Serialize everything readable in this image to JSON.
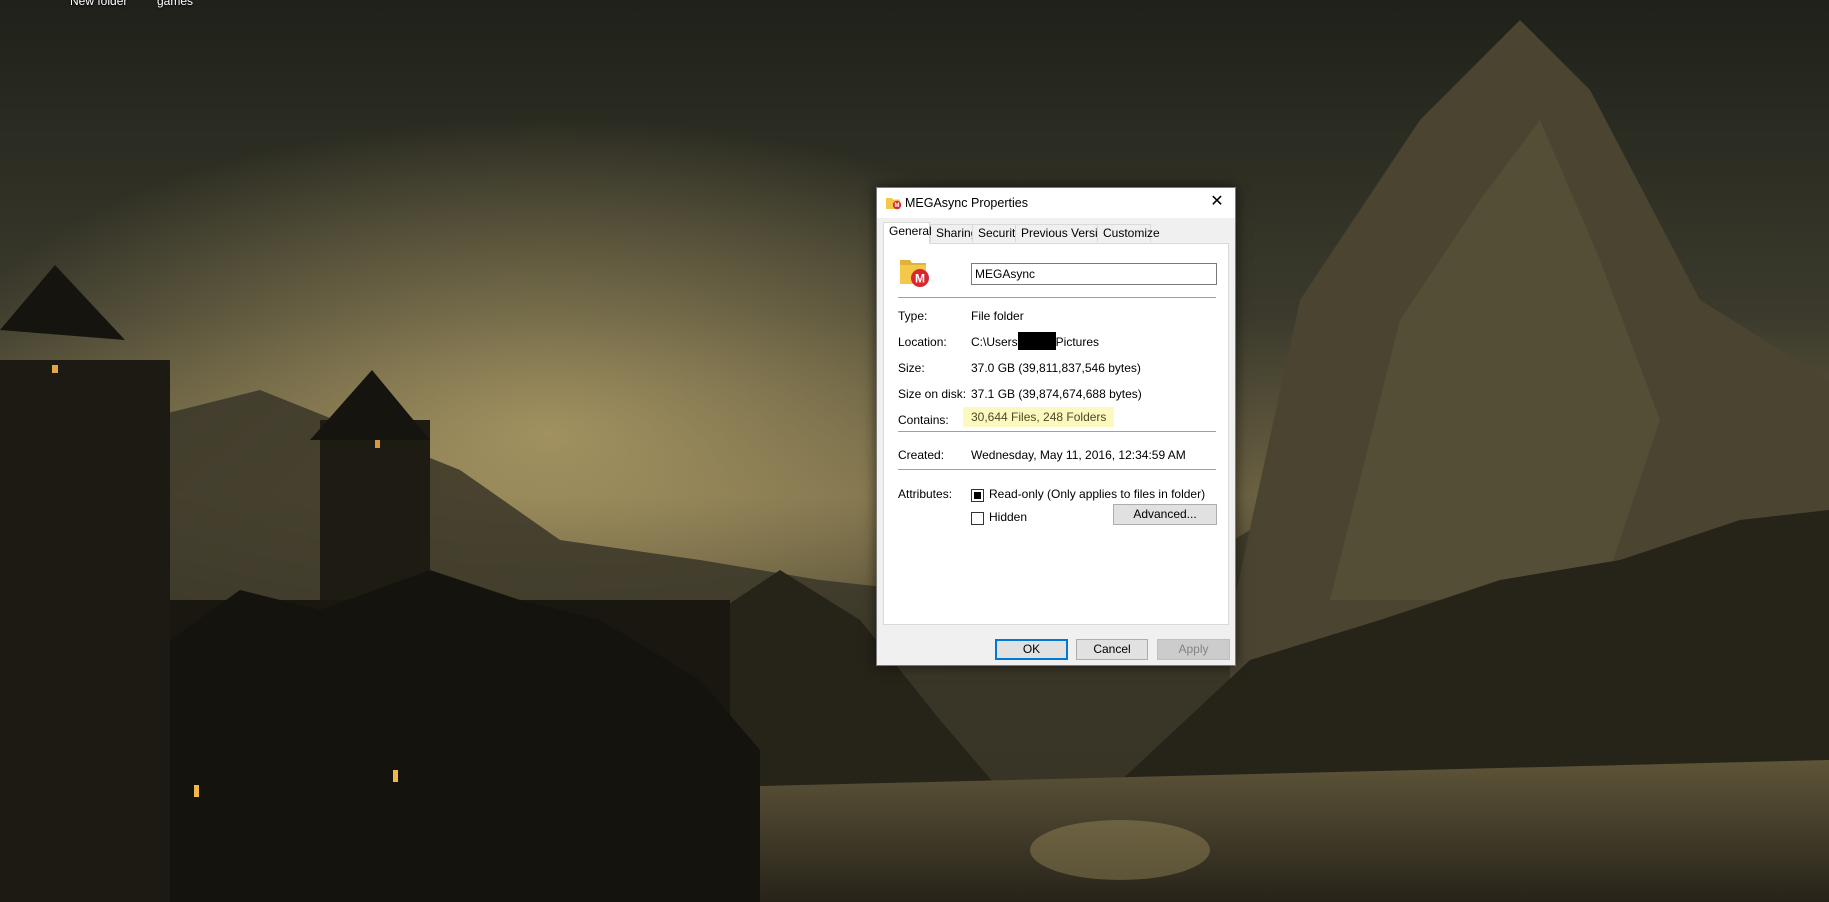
{
  "desktop": {
    "icons": [
      {
        "label": "New folder"
      },
      {
        "label": "games"
      }
    ]
  },
  "dialog": {
    "title": "MEGAsync Properties",
    "close_glyph": "✕",
    "tabs": [
      "General",
      "Sharing",
      "Security",
      "Previous Versions",
      "Customize"
    ],
    "active_tab": "General",
    "name_value": "MEGAsync",
    "type_label": "Type:",
    "type_value": "File folder",
    "location_label": "Location:",
    "location_prefix": "C:\\Users",
    "location_suffix": "Pictures",
    "size_label": "Size:",
    "size_value": "37.0 GB (39,811,837,546 bytes)",
    "size_on_disk_label": "Size on disk:",
    "size_on_disk_value": "37.1 GB (39,874,674,688 bytes)",
    "contains_label": "Contains:",
    "contains_value": "30,644 Files, 248 Folders",
    "created_label": "Created:",
    "created_value": "Wednesday, May 11, 2016, 12:34:59 AM",
    "attributes_label": "Attributes:",
    "readonly_label": "Read-only (Only applies to files in folder)",
    "readonly_state": "indeterminate",
    "hidden_label": "Hidden",
    "hidden_checked": false,
    "advanced_label": "Advanced...",
    "ok_label": "OK",
    "cancel_label": "Cancel",
    "apply_label": "Apply"
  },
  "colors": {
    "mega_red": "#d9272e",
    "folder_yellow": "#f4c94b",
    "focus_blue": "#0078d7",
    "highlight": "#fbf8c0"
  },
  "icons": {
    "folder": "mega-folder-icon",
    "close": "close-icon"
  }
}
